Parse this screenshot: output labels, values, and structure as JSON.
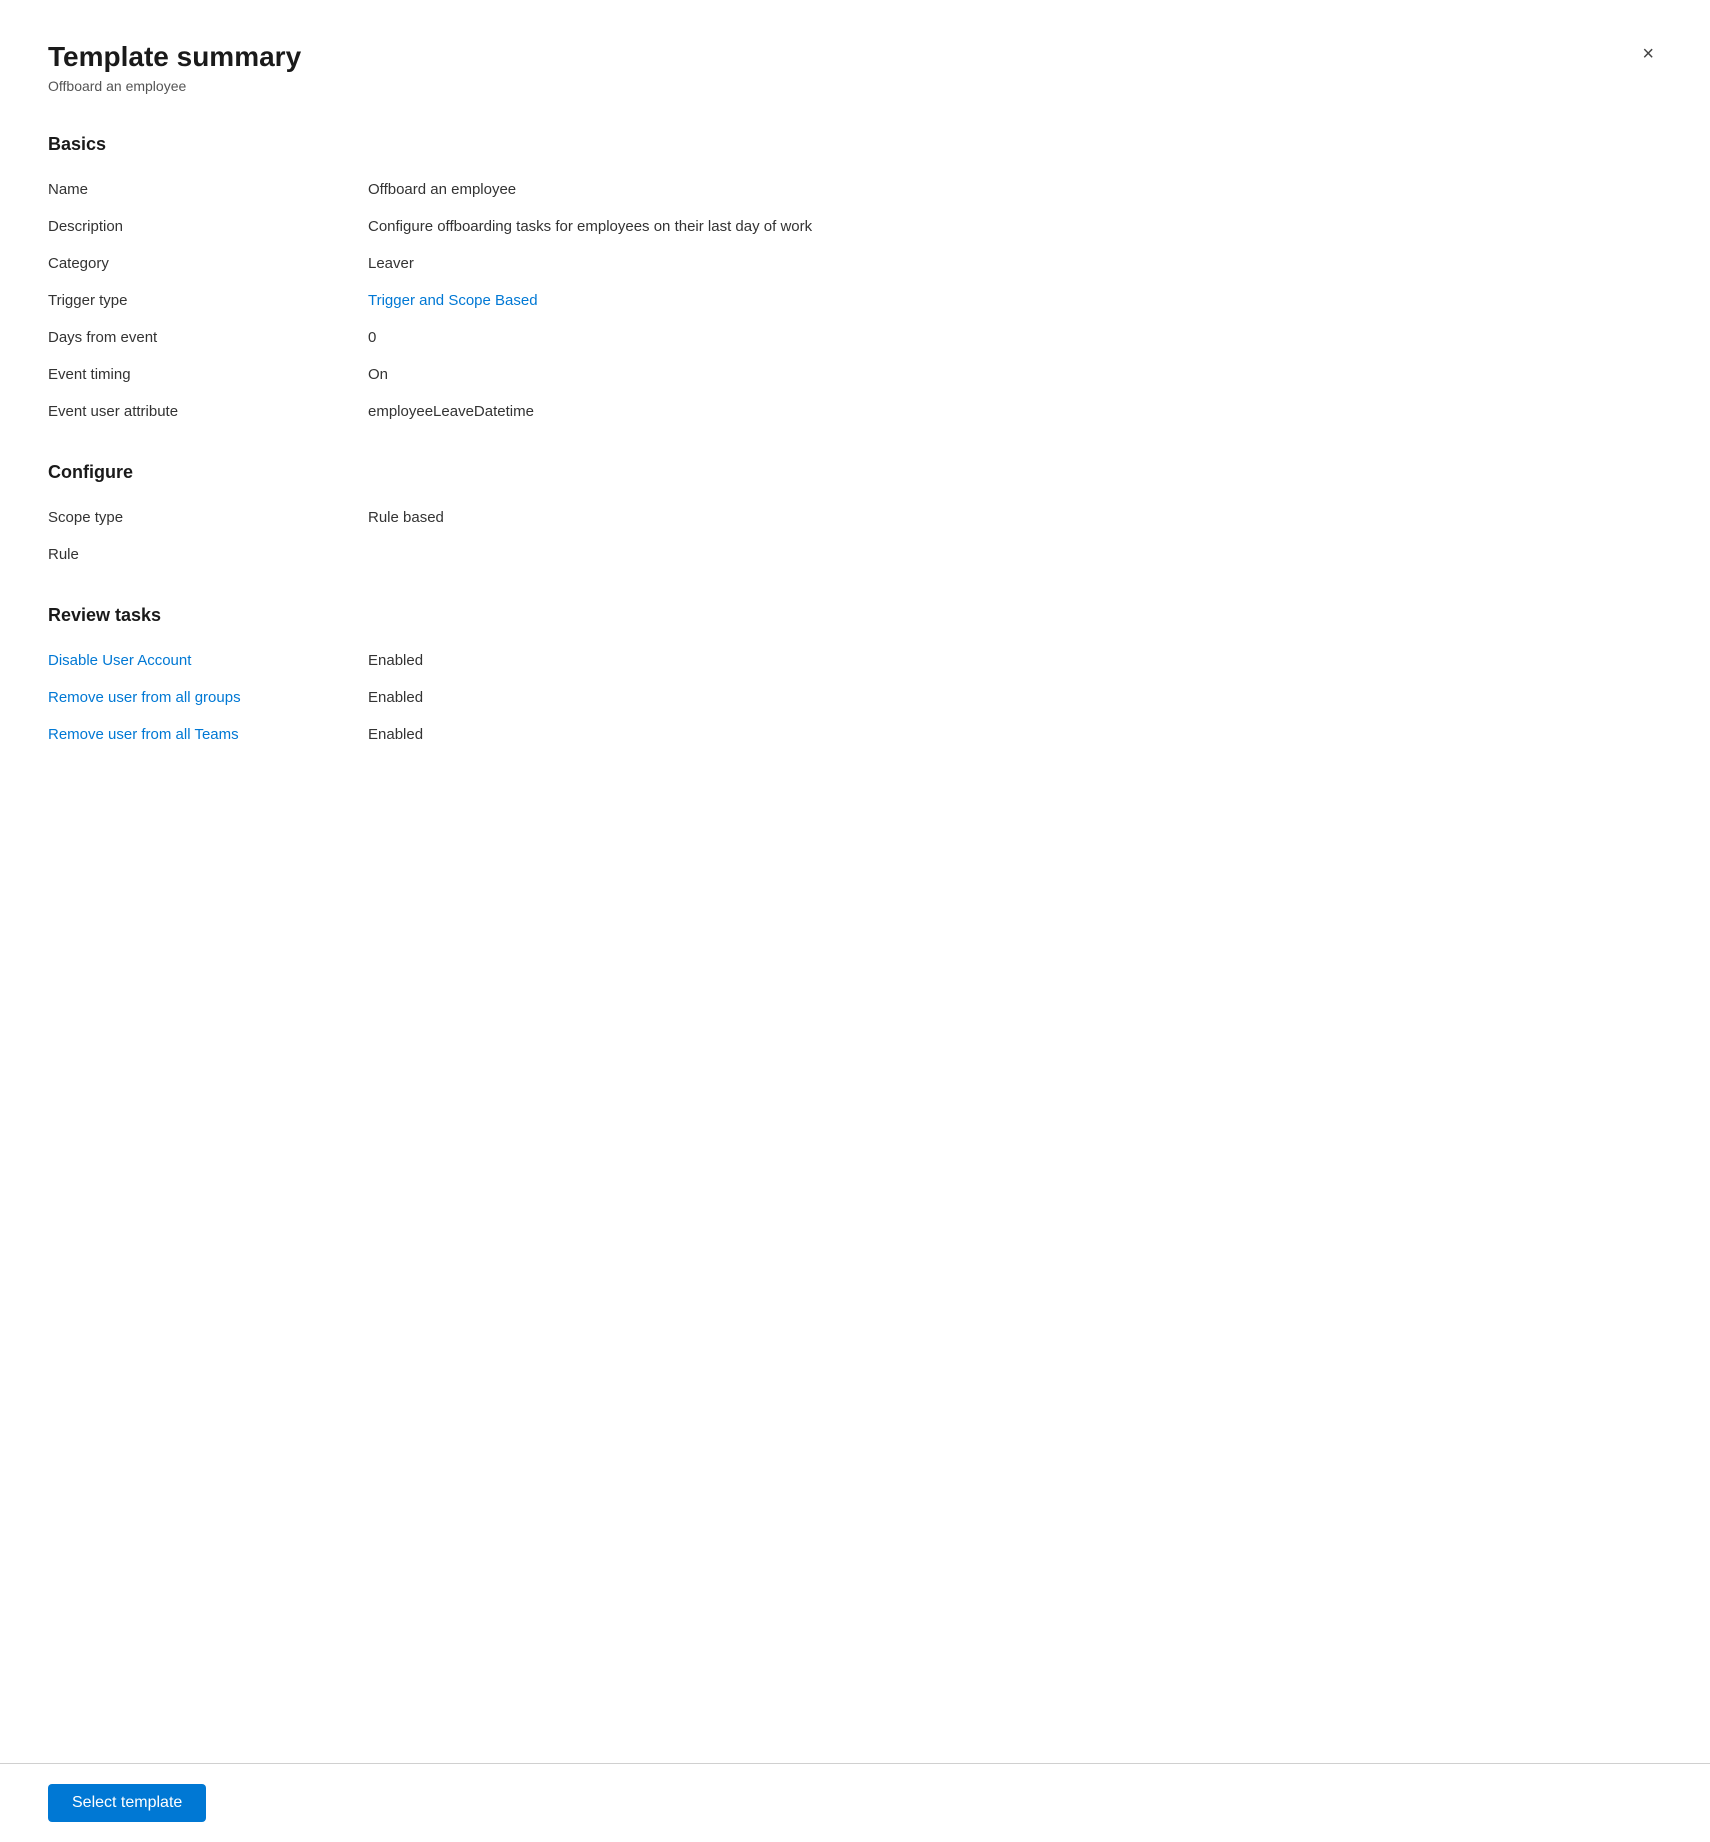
{
  "panel": {
    "title": "Template summary",
    "subtitle": "Offboard an employee",
    "close_label": "×"
  },
  "sections": {
    "basics": {
      "heading": "Basics",
      "fields": [
        {
          "label": "Name",
          "value": "Offboard an employee",
          "link": false
        },
        {
          "label": "Description",
          "value": "Configure offboarding tasks for employees on their last day of work",
          "link": false
        },
        {
          "label": "Category",
          "value": "Leaver",
          "link": false
        },
        {
          "label": "Trigger type",
          "value": "Trigger and Scope Based",
          "link": true
        },
        {
          "label": "Days from event",
          "value": "0",
          "link": false
        },
        {
          "label": "Event timing",
          "value": "On",
          "link": false
        },
        {
          "label": "Event user attribute",
          "value": "employeeLeaveDatetime",
          "link": false
        }
      ]
    },
    "configure": {
      "heading": "Configure",
      "fields": [
        {
          "label": "Scope type",
          "value": "Rule based",
          "link": false
        },
        {
          "label": "Rule",
          "value": "",
          "link": false
        }
      ]
    },
    "review_tasks": {
      "heading": "Review tasks",
      "fields": [
        {
          "label": "Disable User Account",
          "value": "Enabled",
          "link": true
        },
        {
          "label": "Remove user from all groups",
          "value": "Enabled",
          "link": true
        },
        {
          "label": "Remove user from all Teams",
          "value": "Enabled",
          "link": true
        }
      ]
    }
  },
  "footer": {
    "select_template_label": "Select template"
  }
}
